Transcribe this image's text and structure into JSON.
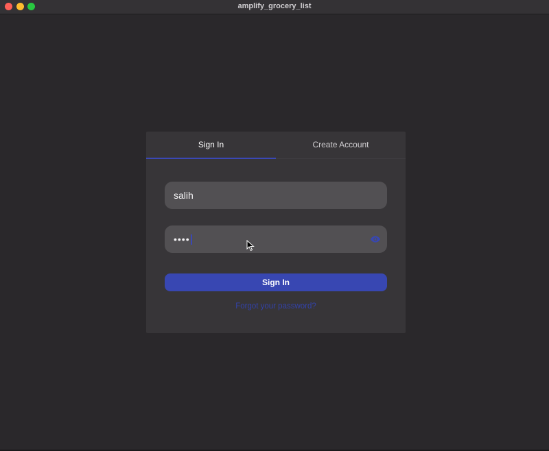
{
  "window": {
    "title": "amplify_grocery_list"
  },
  "tabs": [
    {
      "label": "Sign In",
      "selected": true
    },
    {
      "label": "Create Account",
      "selected": false
    }
  ],
  "form": {
    "username_value": "salih",
    "password_value": "••••",
    "submit_label": "Sign In",
    "forgot_label": "Forgot your password?"
  },
  "colors": {
    "accent": "#3847b2",
    "background": "#2a282b",
    "card": "#373538",
    "field": "#525053"
  },
  "icons": {
    "password_toggle": "eye-icon",
    "pointer": "mouse-pointer-icon"
  }
}
